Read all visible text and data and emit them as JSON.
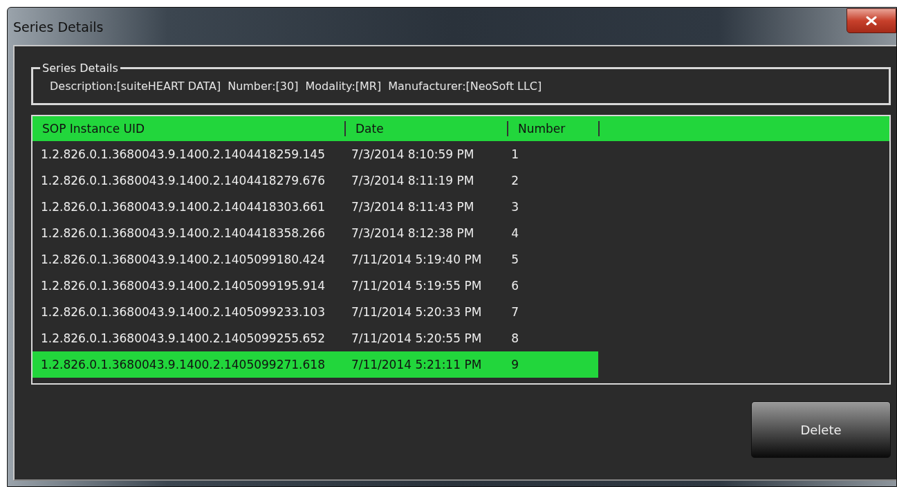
{
  "window": {
    "title": "Series Details"
  },
  "series_details": {
    "legend": "Series Details",
    "fields": [
      "Description:[suiteHEART DATA]",
      "Number:[30]",
      "Modality:[MR]",
      "Manufacturer:[NeoSoft LLC]"
    ]
  },
  "table": {
    "columns": [
      "SOP Instance UID",
      "Date",
      "Number"
    ],
    "rows": [
      {
        "uid": "1.2.826.0.1.3680043.9.1400.2.1404418259.145",
        "date": "7/3/2014 8:10:59 PM",
        "number": "1",
        "selected": false
      },
      {
        "uid": "1.2.826.0.1.3680043.9.1400.2.1404418279.676",
        "date": "7/3/2014 8:11:19 PM",
        "number": "2",
        "selected": false
      },
      {
        "uid": "1.2.826.0.1.3680043.9.1400.2.1404418303.661",
        "date": "7/3/2014 8:11:43 PM",
        "number": "3",
        "selected": false
      },
      {
        "uid": "1.2.826.0.1.3680043.9.1400.2.1404418358.266",
        "date": "7/3/2014 8:12:38 PM",
        "number": "4",
        "selected": false
      },
      {
        "uid": "1.2.826.0.1.3680043.9.1400.2.1405099180.424",
        "date": "7/11/2014 5:19:40 PM",
        "number": "5",
        "selected": false
      },
      {
        "uid": "1.2.826.0.1.3680043.9.1400.2.1405099195.914",
        "date": "7/11/2014 5:19:55 PM",
        "number": "6",
        "selected": false
      },
      {
        "uid": "1.2.826.0.1.3680043.9.1400.2.1405099233.103",
        "date": "7/11/2014 5:20:33 PM",
        "number": "7",
        "selected": false
      },
      {
        "uid": "1.2.826.0.1.3680043.9.1400.2.1405099255.652",
        "date": "7/11/2014 5:20:55 PM",
        "number": "8",
        "selected": false
      },
      {
        "uid": "1.2.826.0.1.3680043.9.1400.2.1405099271.618",
        "date": "7/11/2014 5:21:11 PM",
        "number": "9",
        "selected": true
      }
    ]
  },
  "buttons": [
    "Delete"
  ]
}
